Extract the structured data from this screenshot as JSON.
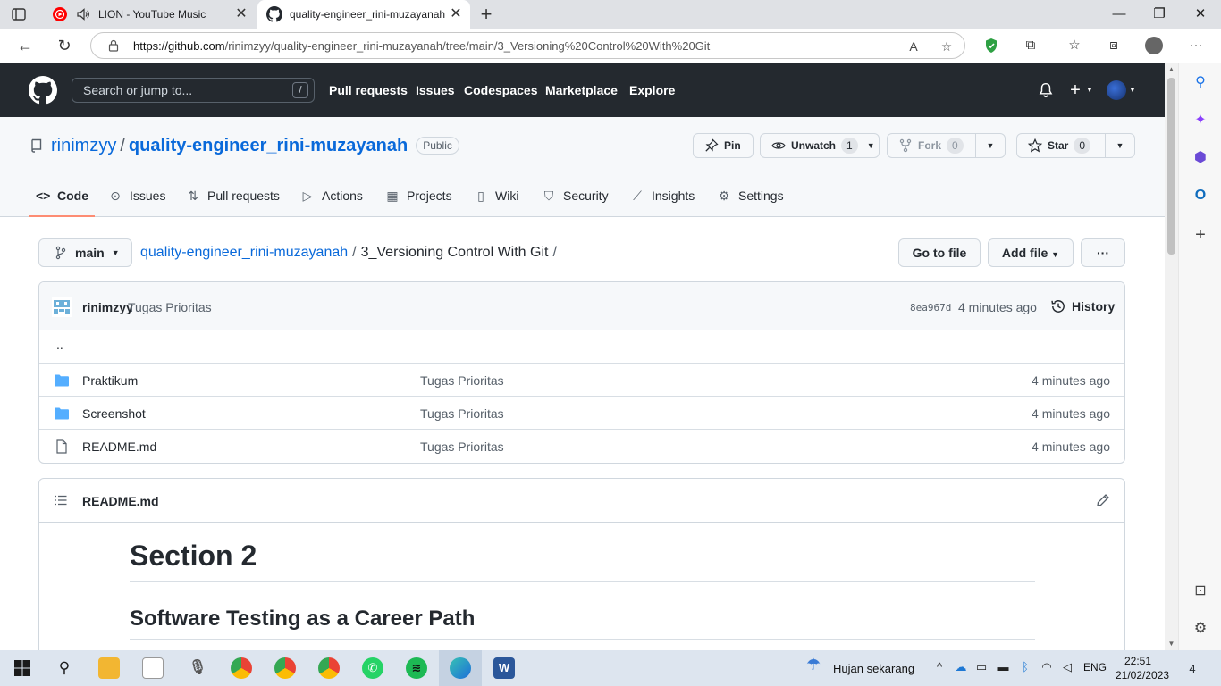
{
  "browser": {
    "tabs": [
      {
        "title": "LION - YouTube Music",
        "active": false
      },
      {
        "title": "quality-engineer_rini-muzayanah",
        "active": true
      }
    ],
    "url_host": "https://github.com",
    "url_path": "/rinimzyy/quality-engineer_rini-muzayanah/tree/main/3_Versioning%20Control%20With%20Git"
  },
  "github_header": {
    "search_placeholder": "Search or jump to...",
    "search_shortcut": "/",
    "nav": [
      "Pull requests",
      "Issues",
      "Codespaces",
      "Marketplace",
      "Explore"
    ]
  },
  "repo": {
    "owner": "rinimzyy",
    "separator": "/",
    "name": "quality-engineer_rini-muzayanah",
    "visibility": "Public",
    "pin_label": "Pin",
    "watch_label": "Unwatch",
    "watch_count": "1",
    "fork_label": "Fork",
    "fork_count": "0",
    "star_label": "Star",
    "star_count": "0",
    "tabs": [
      "Code",
      "Issues",
      "Pull requests",
      "Actions",
      "Projects",
      "Wiki",
      "Security",
      "Insights",
      "Settings"
    ]
  },
  "filenav": {
    "branch": "main",
    "crumb_root": "quality-engineer_rini-muzayanah",
    "crumb_sep": "/",
    "crumb_current": "3_Versioning Control With Git",
    "crumb_trail": "/",
    "go_to_file": "Go to file",
    "add_file": "Add file",
    "more": "···"
  },
  "commit": {
    "author": "rinimzyy",
    "message": "Tugas Prioritas",
    "sha": "8ea967d",
    "time": "4 minutes ago",
    "history": "History"
  },
  "files": {
    "up": "..",
    "rows": [
      {
        "name": "Praktikum",
        "type": "dir",
        "message": "Tugas Prioritas",
        "age": "4 minutes ago"
      },
      {
        "name": "Screenshot",
        "type": "dir",
        "message": "Tugas Prioritas",
        "age": "4 minutes ago"
      },
      {
        "name": "README.md",
        "type": "file",
        "message": "Tugas Prioritas",
        "age": "4 minutes ago"
      }
    ]
  },
  "readme": {
    "title": "README.md",
    "h1": "Section 2",
    "h2": "Software Testing as a Career Path"
  },
  "taskbar": {
    "weather": "Hujan sekarang",
    "lang": "ENG",
    "time": "22:51",
    "date": "21/02/2023",
    "notifications": "4"
  },
  "colors": {
    "github_header": "#24292f",
    "link": "#0969da",
    "tab_underline": "#fd8c73",
    "folder": "#54aeff"
  }
}
